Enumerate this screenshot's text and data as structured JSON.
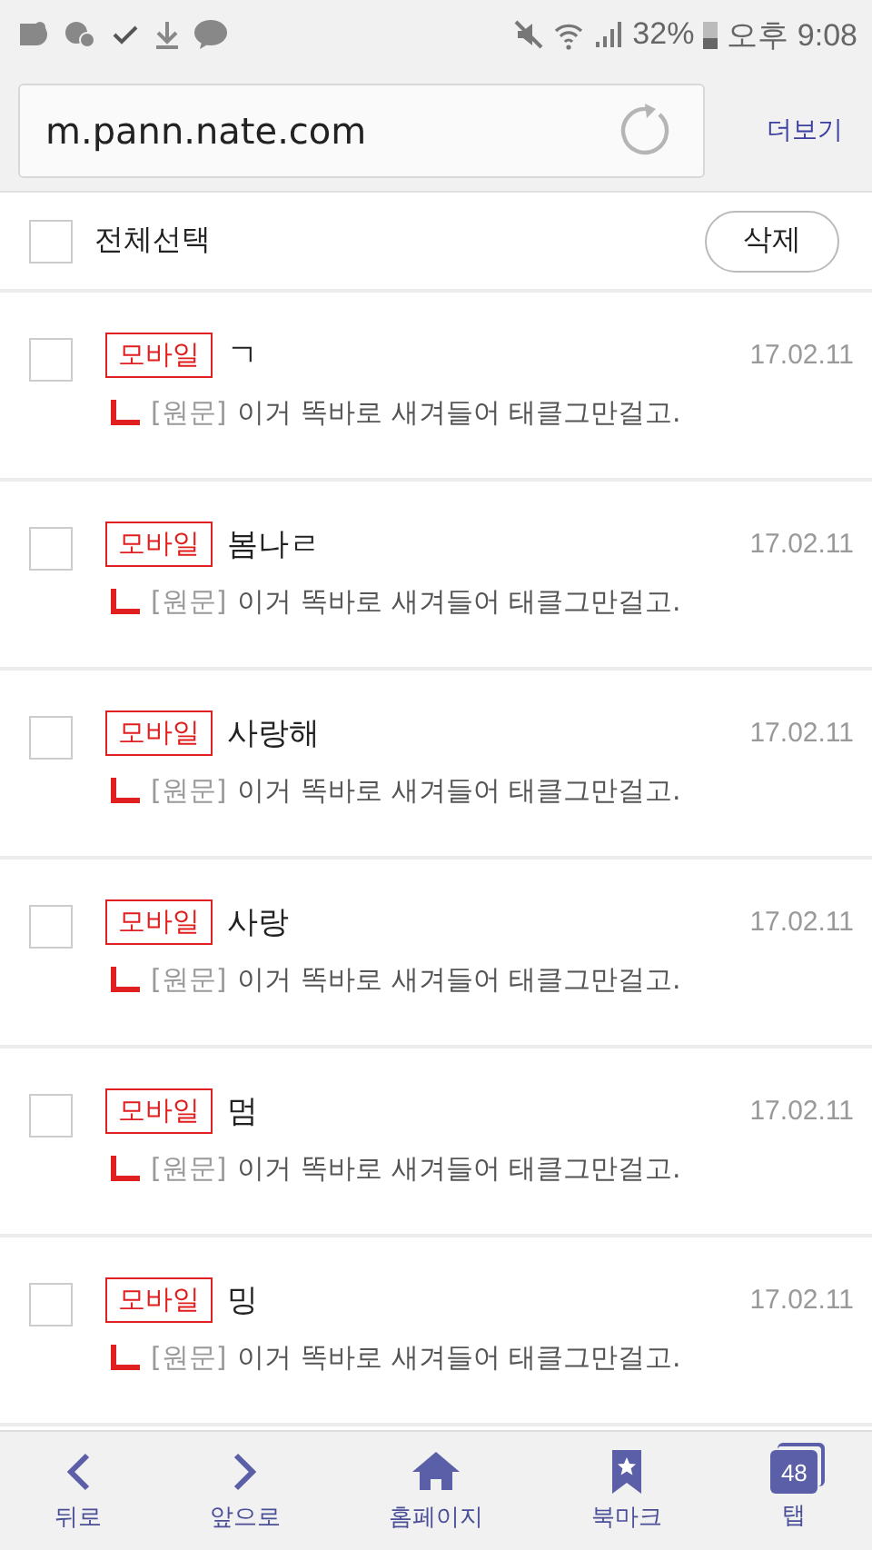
{
  "status_bar": {
    "battery": "32%",
    "time": "오후 9:08"
  },
  "address_bar": {
    "url": "m.pann.nate.com",
    "more": "더보기"
  },
  "toolbar": {
    "select_all": {
      "label": "전체선택",
      "checked": false
    },
    "delete_button": "삭제"
  },
  "comments": [
    {
      "checked": false,
      "badge": "모바일",
      "title": "ㄱ",
      "date": "17.02.11",
      "tag": "[원문]",
      "original": "이거 똑바로 새겨들어 태클그만걸고."
    },
    {
      "checked": false,
      "badge": "모바일",
      "title": "봄나ㄹ",
      "date": "17.02.11",
      "tag": "[원문]",
      "original": "이거 똑바로 새겨들어 태클그만걸고."
    },
    {
      "checked": false,
      "badge": "모바일",
      "title": "사랑해",
      "date": "17.02.11",
      "tag": "[원문]",
      "original": "이거 똑바로 새겨들어 태클그만걸고."
    },
    {
      "checked": false,
      "badge": "모바일",
      "title": "사랑",
      "date": "17.02.11",
      "tag": "[원문]",
      "original": "이거 똑바로 새겨들어 태클그만걸고."
    },
    {
      "checked": false,
      "badge": "모바일",
      "title": "멈",
      "date": "17.02.11",
      "tag": "[원문]",
      "original": "이거 똑바로 새겨들어 태클그만걸고."
    },
    {
      "checked": false,
      "badge": "모바일",
      "title": "밍",
      "date": "17.02.11",
      "tag": "[원문]",
      "original": "이거 똑바로 새겨들어 태클그만걸고."
    }
  ],
  "bottom_nav": [
    {
      "kind": "back",
      "label": "뒤로"
    },
    {
      "kind": "forward",
      "label": "앞으로"
    },
    {
      "kind": "home",
      "label": "홈페이지"
    },
    {
      "kind": "bookmark",
      "label": "북마크"
    },
    {
      "kind": "tabs",
      "label": "탭",
      "count": "48"
    }
  ]
}
